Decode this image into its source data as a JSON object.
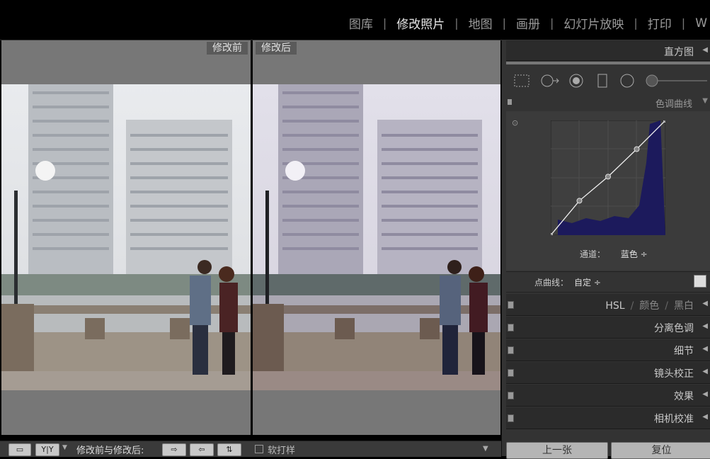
{
  "modules": [
    "图库",
    "修改照片",
    "地图",
    "画册",
    "幻灯片放映",
    "打印",
    "W"
  ],
  "active_module_index": 1,
  "compare": {
    "before_label": "修改前",
    "after_label": "修改后"
  },
  "bottombar": {
    "view_icon": "loupe-view-icon",
    "yy_label": "Y|Y",
    "compare_label": "修改前与修改后:",
    "softproof_label": "软打样"
  },
  "panel": {
    "histogram_title": "直方图",
    "tone_curve_title": "色调曲线",
    "channel_label": "通道：",
    "channel_value": "蓝色 ÷",
    "point_curve_label": "点曲线：",
    "point_curve_value": "自定 ÷",
    "hsl_items": [
      "HSL",
      "颜色",
      "黑白"
    ],
    "sections": [
      "分离色调",
      "细节",
      "镜头校正",
      "效果",
      "相机校准"
    ],
    "prev_button": "上一张",
    "reset_button": "复位"
  },
  "curve": {
    "channel_color": "#1c1a5c",
    "points": [
      [
        0,
        0
      ],
      [
        0.25,
        0.3
      ],
      [
        0.5,
        0.51
      ],
      [
        0.75,
        0.75
      ],
      [
        1,
        1
      ]
    ]
  }
}
